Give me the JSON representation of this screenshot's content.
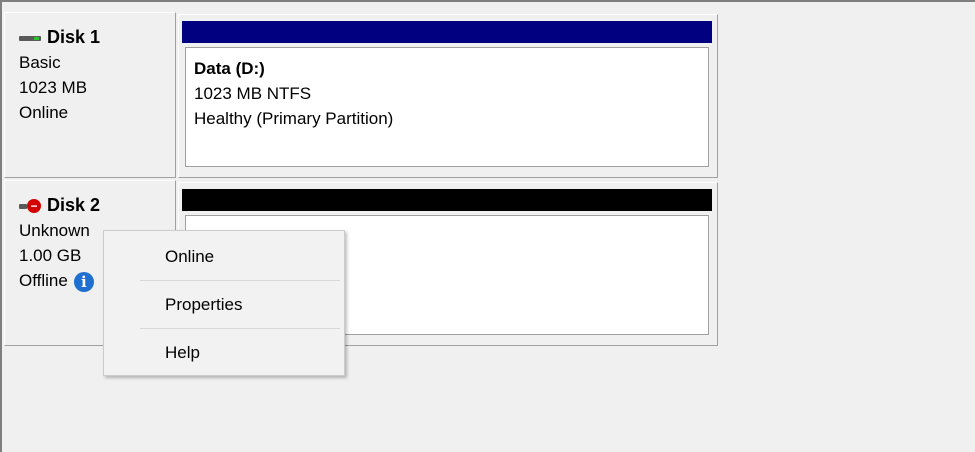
{
  "disks": [
    {
      "title": "Disk 1",
      "type": "Basic",
      "size": "1023 MB",
      "status": "Online",
      "volume": {
        "name": "Data  (D:)",
        "detail": "1023 MB NTFS",
        "health": "Healthy (Primary Partition)",
        "stripe_color": "#000080"
      }
    },
    {
      "title": "Disk 2",
      "type": "Unknown",
      "size": "1.00 GB",
      "status": "Offline",
      "volume": {
        "stripe_color": "#000000"
      }
    }
  ],
  "context_menu": {
    "items": [
      "Online",
      "Properties",
      "Help"
    ]
  },
  "icons": {
    "disk1": "disk-online-icon",
    "disk2": "disk-offline-error-icon",
    "status_info": "info-icon"
  }
}
